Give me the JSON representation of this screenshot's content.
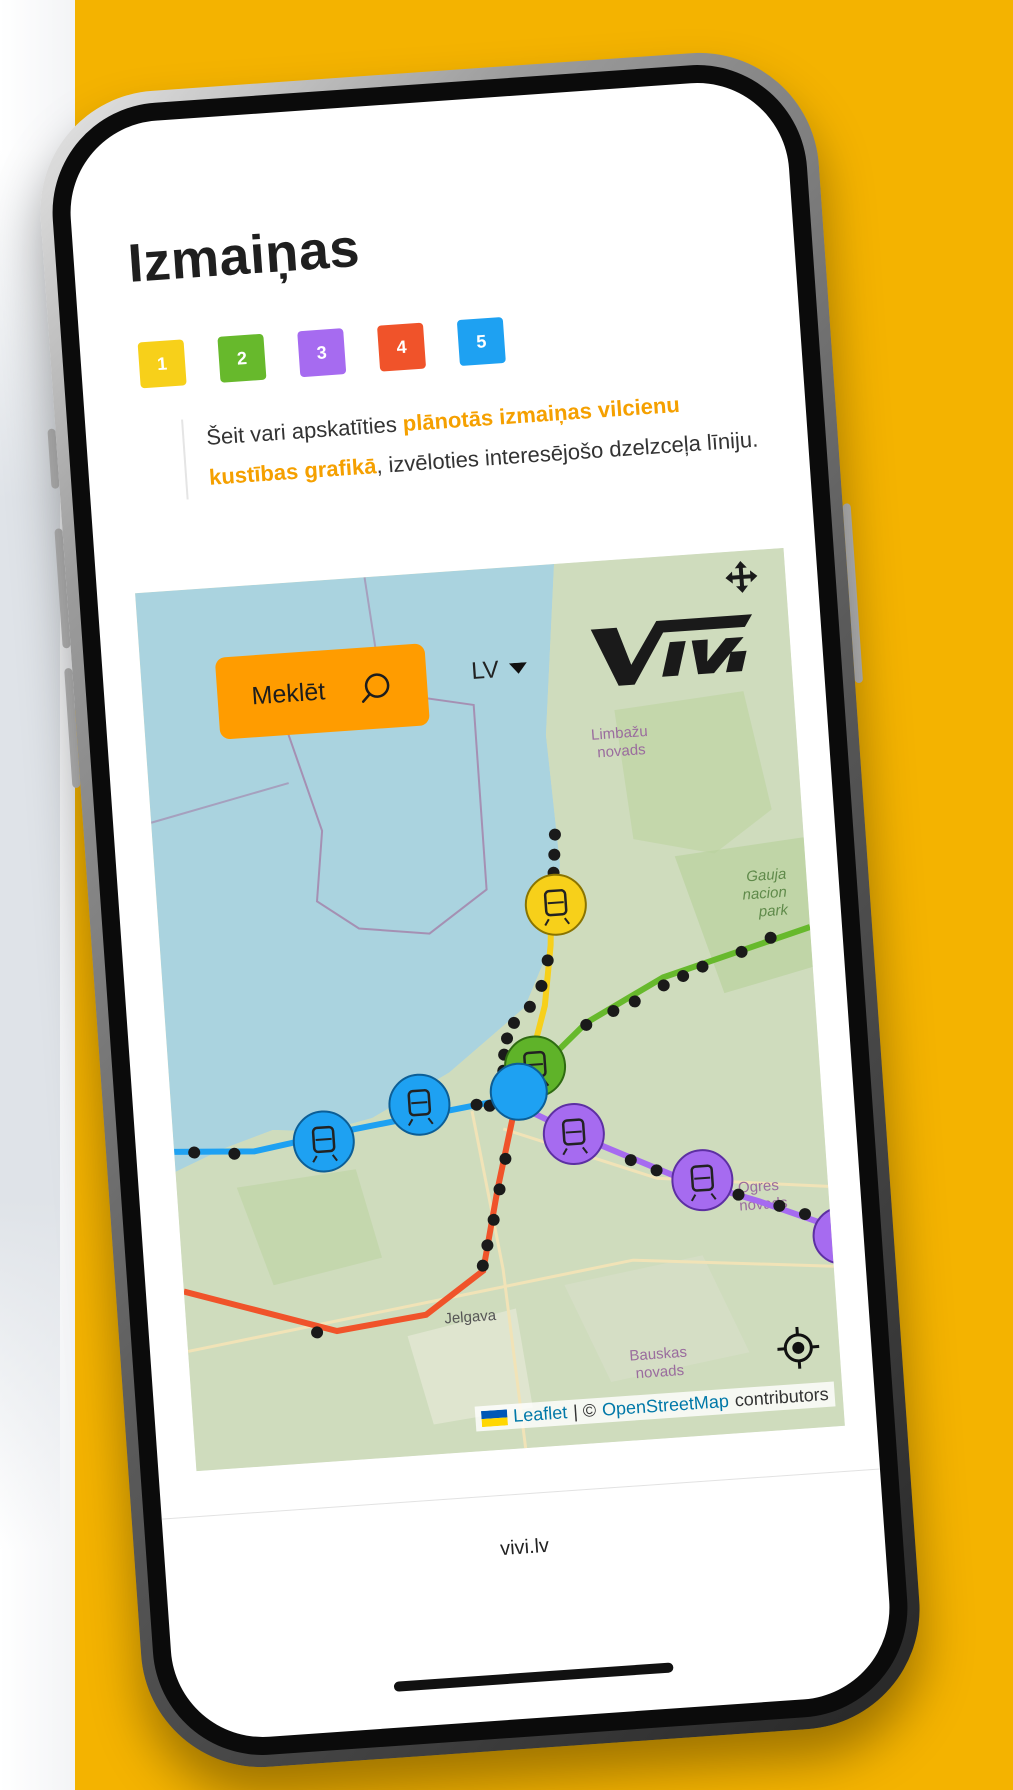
{
  "page": {
    "title": "Izmaiņas",
    "tabs": [
      {
        "label": "1",
        "color": "#F7D01A"
      },
      {
        "label": "2",
        "color": "#67B92C"
      },
      {
        "label": "3",
        "color": "#A66BF0"
      },
      {
        "label": "4",
        "color": "#F0532A"
      },
      {
        "label": "5",
        "color": "#1EA1F2"
      }
    ],
    "description": {
      "prefix": "Šeit vari apskatīties ",
      "highlight": "plānotās izmaiņas vilcienu kustības grafikā",
      "suffix": ", izvēloties interesējošo dzelzceļa līniju."
    },
    "accent_color": "#F5A000"
  },
  "map": {
    "search_label": "Meklēt",
    "language": "LV",
    "logo_text": "VIVI",
    "labels": [
      "Limbažu novads",
      "Gaujas nacionālais parks",
      "Ogres novads",
      "Bauskas novads",
      "Jelgava"
    ],
    "attribution": {
      "leaflet": "Leaflet",
      "separator": "| ©",
      "osm": "OpenStreetMap",
      "suffix": "contributors"
    },
    "icons": [
      "search-icon",
      "dropdown-arrow-icon",
      "move-icon",
      "locate-icon",
      "train-icon",
      "ukraine-flag-icon"
    ]
  },
  "footer": {
    "domain": "vivi.lv"
  }
}
